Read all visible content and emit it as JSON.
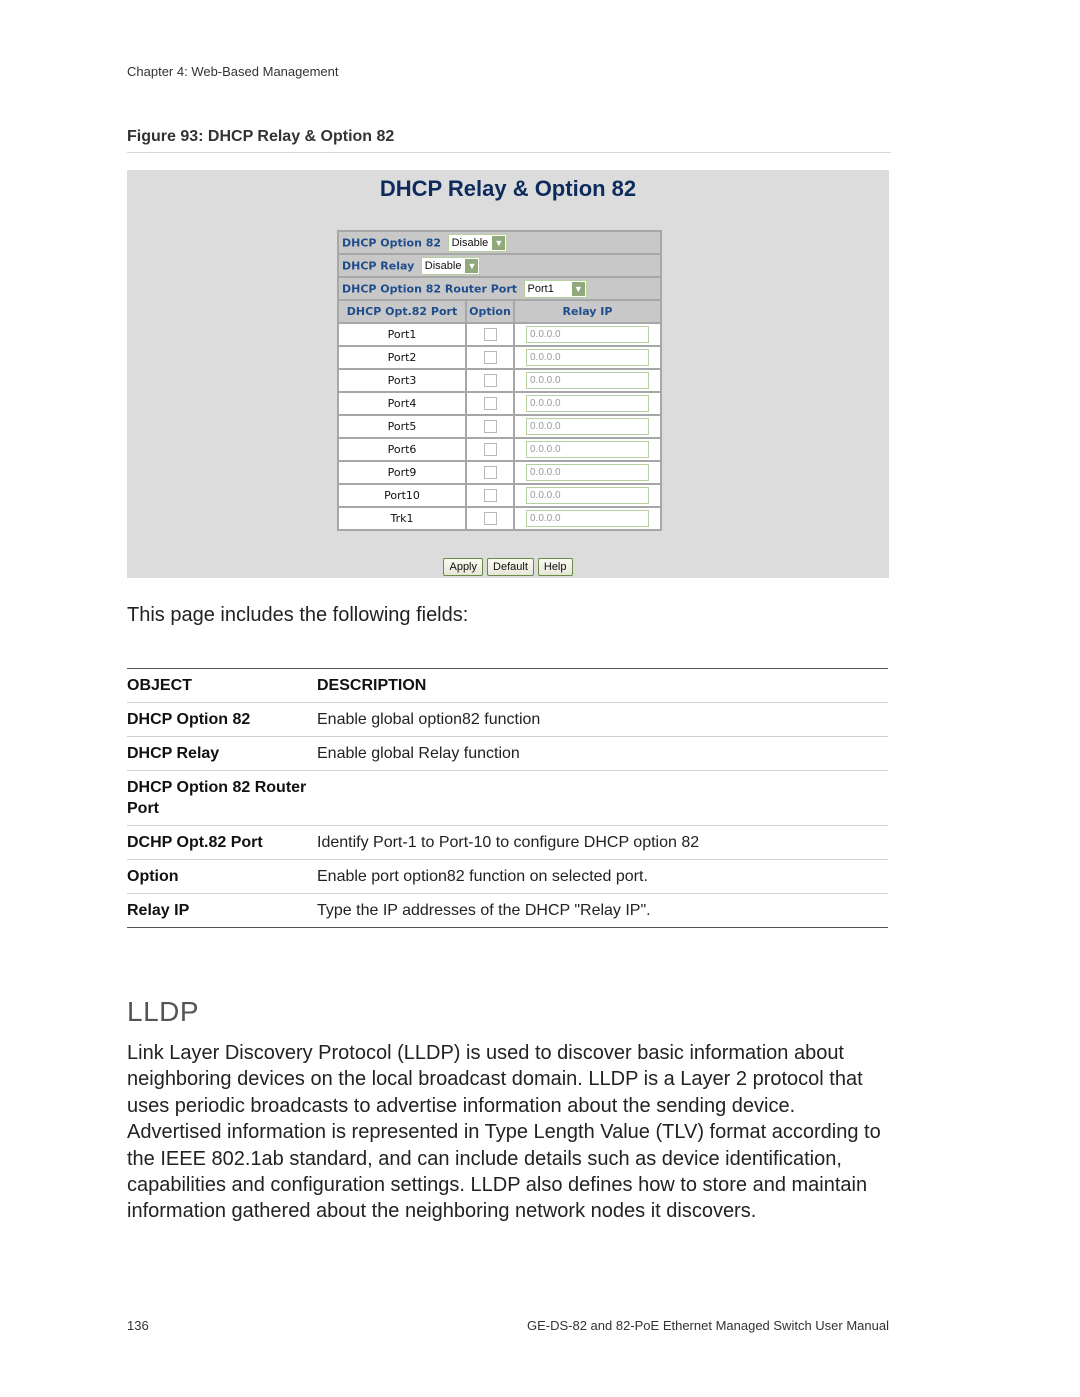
{
  "header": {
    "running_title": "Chapter 4: Web-Based Management"
  },
  "figure": {
    "caption": "Figure 93: DHCP Relay & Option 82",
    "ui": {
      "title": "DHCP Relay & Option 82",
      "settings": [
        {
          "label": "DHCP Option 82",
          "value": "Disable"
        },
        {
          "label": "DHCP Relay",
          "value": "Disable"
        },
        {
          "label": "DHCP Option 82 Router Port",
          "value": "Port1"
        }
      ],
      "columns": [
        "DHCP Opt.82 Port",
        "Option",
        "Relay IP"
      ],
      "ports": [
        {
          "port": "Port1",
          "option_checked": false,
          "relay_ip": "0.0.0.0"
        },
        {
          "port": "Port2",
          "option_checked": false,
          "relay_ip": "0.0.0.0"
        },
        {
          "port": "Port3",
          "option_checked": false,
          "relay_ip": "0.0.0.0"
        },
        {
          "port": "Port4",
          "option_checked": false,
          "relay_ip": "0.0.0.0"
        },
        {
          "port": "Port5",
          "option_checked": false,
          "relay_ip": "0.0.0.0"
        },
        {
          "port": "Port6",
          "option_checked": false,
          "relay_ip": "0.0.0.0"
        },
        {
          "port": "Port9",
          "option_checked": false,
          "relay_ip": "0.0.0.0"
        },
        {
          "port": "Port10",
          "option_checked": false,
          "relay_ip": "0.0.0.0"
        },
        {
          "port": "Trk1",
          "option_checked": false,
          "relay_ip": "0.0.0.0"
        }
      ],
      "buttons": {
        "apply": "Apply",
        "default": "Default",
        "help": "Help"
      },
      "colors": {
        "title": "#0e2b5e",
        "label": "#1f4d8c",
        "panel_bg": "#dcdcdc"
      }
    }
  },
  "intro": "This page includes the following fields:",
  "fields_table": {
    "headers": [
      "OBJECT",
      "DESCRIPTION"
    ],
    "rows": [
      {
        "object": "DHCP Option 82",
        "description": "Enable global option82 function"
      },
      {
        "object": "DHCP Relay",
        "description": "Enable global Relay function"
      },
      {
        "object": "DHCP Option 82 Router Port",
        "description": ""
      },
      {
        "object": "DCHP Opt.82 Port",
        "description": "Identify Port-1 to Port-10 to configure DHCP option 82"
      },
      {
        "object": "Option",
        "description": "Enable port option82 function on selected port."
      },
      {
        "object": "Relay IP",
        "description": "Type the IP addresses of the DHCP \"Relay IP\"."
      }
    ]
  },
  "lldp": {
    "heading": "LLDP",
    "body": "Link Layer Discovery Protocol (LLDP) is used to discover basic information about neighboring devices on the local broadcast domain. LLDP is a Layer 2 protocol that uses periodic broadcasts to advertise information about the sending device. Advertised information is represented in Type Length Value (TLV) format according to the IEEE 802.1ab standard, and can include details such as device identification, capabilities and configuration settings. LLDP also defines how to store and maintain information gathered about the neighboring network nodes it discovers."
  },
  "footer": {
    "page_number": "136",
    "manual_title": "GE-DS-82 and 82-PoE Ethernet Managed Switch User Manual"
  }
}
